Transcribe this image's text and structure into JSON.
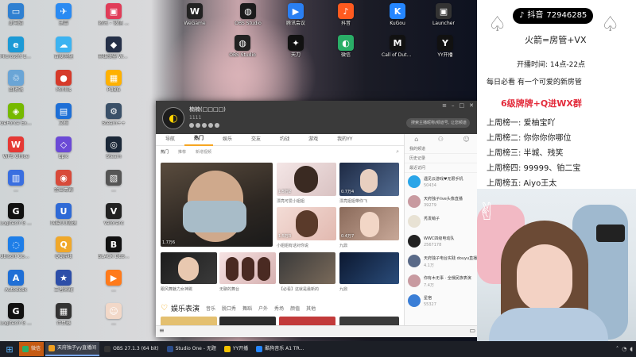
{
  "desktop_icons": [
    {
      "label": "此电脑",
      "color": "#2f80d1",
      "glyph": "▭"
    },
    {
      "label": "迅雷",
      "color": "#2a8af2",
      "glyph": "✈"
    },
    {
      "label": "腾讯 – 微信 ...",
      "color": "#e03c58",
      "glyph": "▣"
    },
    {
      "label": "Microsoft Edge",
      "color": "#1c9ad6",
      "glyph": "e"
    },
    {
      "label": "百度网盘",
      "color": "#3cb3f1",
      "glyph": "☁"
    },
    {
      "label": "英雄联盟 WeGame版",
      "color": "#253048",
      "glyph": "◆"
    },
    {
      "label": "回收站",
      "color": "#6aa5d6",
      "glyph": "♲"
    },
    {
      "label": "Mirillis",
      "color": "#d63a2a",
      "glyph": "●"
    },
    {
      "label": "PUBG",
      "color": "#ffb100",
      "glyph": "▦"
    },
    {
      "label": "GeForce Experience",
      "color": "#76b900",
      "glyph": "◈"
    },
    {
      "label": "文档",
      "color": "#1e6fd6",
      "glyph": "▤"
    },
    {
      "label": "Steam++",
      "color": "#3a5068",
      "glyph": "⚙"
    },
    {
      "label": "WPS Office",
      "color": "#e53935",
      "glyph": "W"
    },
    {
      "label": "Epic",
      "color": "#6b4ad6",
      "glyph": "◇"
    },
    {
      "label": "Steam",
      "color": "#1b2838",
      "glyph": "◎"
    },
    {
      "label": "...",
      "color": "#3a6fe0",
      "glyph": "▥"
    },
    {
      "label": "金山毒霸",
      "color": "#d84a3a",
      "glyph": "◉"
    },
    {
      "label": "...",
      "color": "#555",
      "glyph": "▧"
    },
    {
      "label": "Logitech G HUB",
      "color": "#111",
      "glyph": "G"
    },
    {
      "label": "网易UU加速",
      "color": "#2f6ad6",
      "glyph": "U"
    },
    {
      "label": "Valorant",
      "color": "#222",
      "glyph": "V"
    },
    {
      "label": "Ubisoft Connect",
      "color": "#1e7ee8",
      "glyph": "◌"
    },
    {
      "label": "QQ游戏",
      "color": "#f0a82a",
      "glyph": "Q"
    },
    {
      "label": "BLACK DESERT",
      "color": "#111",
      "glyph": "B"
    },
    {
      "label": "Autodesk",
      "color": "#1f6fd6",
      "glyph": "A"
    },
    {
      "label": "王者荣耀",
      "color": "#2d4ea8",
      "glyph": "★"
    },
    {
      "label": "...",
      "color": "#ff7a1a",
      "glyph": "▶"
    },
    {
      "label": "Logitech G HUB",
      "color": "#111",
      "glyph": "G"
    },
    {
      "label": "计算器",
      "color": "#333",
      "glyph": "▦"
    },
    {
      "label": "...",
      "color": "#f2d8c8",
      "glyph": "☺"
    }
  ],
  "top_icons": [
    {
      "label": "WeGame",
      "color": "#222",
      "glyph": "W"
    },
    {
      "label": "OBS Studio",
      "color": "#1b1b1b",
      "glyph": "◍"
    },
    {
      "label": "腾讯会议",
      "color": "#2a7ff2",
      "glyph": "▶"
    },
    {
      "label": "抖音",
      "color": "#ff5a1f",
      "glyph": "♪"
    },
    {
      "label": "OBS Studio",
      "color": "#222",
      "glyph": "◍"
    },
    {
      "label": "天刀",
      "color": "#111",
      "glyph": "✦"
    },
    {
      "label": "微信",
      "color": "#2aae67",
      "glyph": "◐"
    },
    {
      "label": "KuGou",
      "color": "#2586ff",
      "glyph": "K"
    },
    {
      "label": "Call of Duty MW",
      "color": "#111",
      "glyph": "M"
    },
    {
      "label": "Launcher",
      "color": "#333",
      "glyph": "▣"
    },
    {
      "label": "YY开播",
      "color": "#111",
      "glyph": "Y"
    }
  ],
  "app": {
    "user_name": "楠楠(□□□□)",
    "user_sub": "1111",
    "search_placeholder": "搜索主播昵称/频道号, 让您频道",
    "tabs": [
      "导航",
      "热门",
      "娱乐",
      "交友",
      "约战",
      "游戏",
      "我的YY"
    ],
    "subtabs": [
      "热门",
      "推荐",
      "新增视频"
    ],
    "tiles": [
      {
        "count": "1.7万6",
        "caption": ""
      },
      {
        "count": "1.5万2",
        "caption": "漂亮可爱小姐姐"
      },
      {
        "count": "0.7万4",
        "caption": "漂亮姐姐带你飞"
      },
      {
        "count": "1.5万3",
        "caption": "小姐姐有话对你说"
      },
      {
        "count": "0.4万7",
        "caption": "九鼎"
      },
      {
        "count": "",
        "caption": "跟风舞魅力女神跳"
      },
      {
        "count": "",
        "caption": "无聊的舞台"
      },
      {
        "count": "",
        "caption": "【必看】这就是最新的"
      },
      {
        "count": "",
        "caption": "九鼎"
      }
    ],
    "section_title": "娱乐表演",
    "section_tabs": [
      "音乐",
      "脱口秀",
      "舞蹈",
      "户外",
      "秀场",
      "颜值",
      "其他"
    ],
    "sidebar_links": [
      "我的频道",
      "历史记录",
      "最近访问"
    ],
    "sidebar_items": [
      {
        "name": "遇见云游戏♥无限手机",
        "stat": "50434",
        "color": "#2aa5e8"
      },
      {
        "name": "天府独子live头像直播",
        "stat": "39279",
        "color": "#c89aa0"
      },
      {
        "name": "秃发萌子",
        "stat": "",
        "color": "#e8e2d4"
      },
      {
        "name": "WWC四级电动队",
        "stat": "2567178",
        "color": "#222"
      },
      {
        "name": "天府独子电台实践 douyu直播",
        "stat": "4.1万",
        "color": "#5a6a88"
      },
      {
        "name": "你有木无事 · 全俄民族表演",
        "stat": "7.4万",
        "color": "#c89aa0"
      },
      {
        "name": "星宿",
        "stat": "55327",
        "color": "#3a7ed6"
      }
    ]
  },
  "overlay": {
    "platform": "抖音",
    "douyin_id": "72946285",
    "line1": "火箭=房管+VX",
    "line2": "开播时间: 14点-22点",
    "line3": "每日必看 有一个可爱的新房管",
    "line4": "6级牌牌+Q进WX群",
    "ranks": [
      "上周榜一: 爱柚宝吖",
      "上周榜二: 你你你你哪位",
      "上周榜三: 半城、残笑",
      "上周榜四: 99999、铂二宝",
      "上周榜五: Aiyo王太"
    ]
  },
  "taskbar": [
    {
      "label": "微信",
      "color": "#2aae67",
      "state": "hl"
    },
    {
      "label": "天府独子yy直播间",
      "color": "#f0a020",
      "state": "active"
    },
    {
      "label": "OBS 27.1.3 (64 bit)",
      "color": "#333",
      "state": ""
    },
    {
      "label": "Studio One - 无题",
      "color": "#2a4c8a",
      "state": ""
    },
    {
      "label": "YY开播",
      "color": "#f2c200",
      "state": ""
    },
    {
      "label": "酷狗音乐 A1 TR...",
      "color": "#2586ff",
      "state": ""
    }
  ],
  "tray_time": "",
  "colors": {
    "accent": "#f6a623",
    "rank_red": "#e32b3b",
    "overlay_text": "#222"
  }
}
